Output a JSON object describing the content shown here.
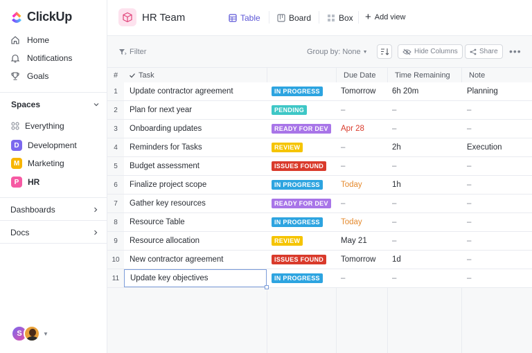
{
  "app": {
    "brand": "ClickUp"
  },
  "sidebar": {
    "nav": [
      {
        "label": "Home",
        "icon": "home-icon"
      },
      {
        "label": "Notifications",
        "icon": "bell-icon"
      },
      {
        "label": "Goals",
        "icon": "trophy-icon"
      }
    ],
    "spaces_label": "Spaces",
    "everything_label": "Everything",
    "spaces": [
      {
        "letter": "D",
        "label": "Development",
        "color": "#7b68ee"
      },
      {
        "letter": "M",
        "label": "Marketing",
        "color": "#f7b500"
      },
      {
        "letter": "P",
        "label": "HR",
        "color": "#f65aa3"
      }
    ],
    "dashboards_label": "Dashboards",
    "docs_label": "Docs",
    "avatar_letter": "S"
  },
  "header": {
    "title": "HR Team",
    "tabs": [
      {
        "label": "Table",
        "active": true
      },
      {
        "label": "Board",
        "active": false
      },
      {
        "label": "Box",
        "active": false
      }
    ],
    "add_view": "Add view"
  },
  "toolbar": {
    "filter": "Filter",
    "group_by_label": "Group by:",
    "group_by_value": "None",
    "hide_columns": "Hide Columns",
    "share": "Share"
  },
  "table": {
    "columns": {
      "num": "#",
      "task": "Task",
      "due": "Due Date",
      "time": "Time Remaining",
      "note": "Note"
    },
    "statuses": {
      "IN PROGRESS": "#2da4e0",
      "PENDING": "#3ec7c6",
      "READY FOR DEV": "#a875e8",
      "REVIEW": "#f5c400",
      "ISSUES FOUND": "#d93a2b"
    },
    "rows": [
      {
        "num": "1",
        "task": "Update contractor agreement",
        "status": "IN PROGRESS",
        "due": "Tomorrow",
        "due_color": "#292d34",
        "time": "6h 20m",
        "note": "Planning"
      },
      {
        "num": "2",
        "task": "Plan for next year",
        "status": "PENDING",
        "due": "–",
        "due_color": "#7c828d",
        "time": "–",
        "note": "–"
      },
      {
        "num": "3",
        "task": "Onboarding updates",
        "status": "READY FOR DEV",
        "due": "Apr 28",
        "due_color": "#d93a2b",
        "time": "–",
        "note": "–"
      },
      {
        "num": "4",
        "task": "Reminders for Tasks",
        "status": "REVIEW",
        "due": "–",
        "due_color": "#7c828d",
        "time": "2h",
        "note": "Execution"
      },
      {
        "num": "5",
        "task": "Budget assessment",
        "status": "ISSUES FOUND",
        "due": "–",
        "due_color": "#7c828d",
        "time": "–",
        "note": "–"
      },
      {
        "num": "6",
        "task": "Finalize project scope",
        "status": "IN PROGRESS",
        "due": "Today",
        "due_color": "#e58a2e",
        "time": "1h",
        "note": "–"
      },
      {
        "num": "7",
        "task": "Gather key resources",
        "status": "READY FOR DEV",
        "due": "–",
        "due_color": "#7c828d",
        "time": "–",
        "note": "–"
      },
      {
        "num": "8",
        "task": "Resource Table",
        "status": "IN PROGRESS",
        "due": "Today",
        "due_color": "#e58a2e",
        "time": "–",
        "note": "–"
      },
      {
        "num": "9",
        "task": "Resource allocation",
        "status": "REVIEW",
        "due": "May 21",
        "due_color": "#292d34",
        "time": "–",
        "note": "–"
      },
      {
        "num": "10",
        "task": "New contractor agreement",
        "status": "ISSUES FOUND",
        "due": "Tomorrow",
        "due_color": "#292d34",
        "time": "1d",
        "note": "–"
      },
      {
        "num": "11",
        "task": "Update key objectives",
        "status": "IN PROGRESS",
        "due": "–",
        "due_color": "#7c828d",
        "time": "–",
        "note": "–"
      }
    ]
  }
}
